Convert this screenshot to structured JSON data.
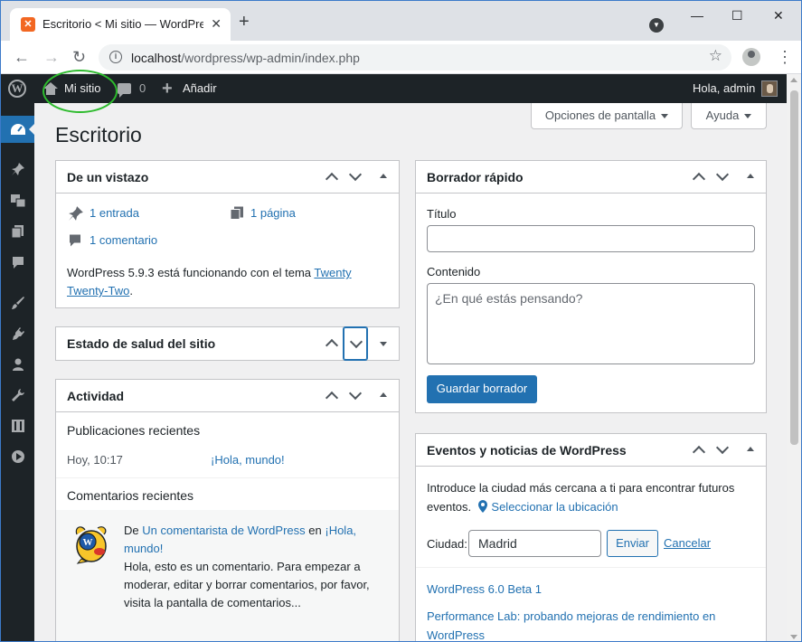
{
  "browser": {
    "tab_title": "Escritorio < Mi sitio — WordPress",
    "tab_close": "✕",
    "new_tab": "+",
    "url_host": "localhost",
    "url_path": "/wordpress/wp-admin/index.php",
    "window_minimize": "—",
    "window_maximize": "☐",
    "window_close": "✕"
  },
  "adminbar": {
    "site_name": "Mi sitio",
    "comments_count": "0",
    "add_new": "Añadir",
    "greeting": "Hola, admin"
  },
  "header": {
    "screen_options": "Opciones de pantalla",
    "help": "Ayuda",
    "title": "Escritorio"
  },
  "glance": {
    "title": "De un vistazo",
    "posts": "1 entrada",
    "pages": "1 página",
    "comments": "1 comentario",
    "running_text": "WordPress 5.9.3 está funcionando con el tema",
    "theme_link": "Twenty Twenty-Two",
    "period": "."
  },
  "health": {
    "title": "Estado de salud del sitio"
  },
  "activity": {
    "title": "Actividad",
    "recent_posts_heading": "Publicaciones recientes",
    "post_date": "Hoy, 10:17",
    "post_title": "¡Hola, mundo!",
    "recent_comments_heading": "Comentarios recientes",
    "comment_from": "De",
    "comment_author": "Un comentarista de WordPress",
    "comment_on": "en",
    "comment_post": "¡Hola, mundo!",
    "comment_excerpt": "Hola, esto es un comentario. Para empezar a moderar, editar y borrar comentarios, por favor, visita la pantalla de comentarios..."
  },
  "quick_draft": {
    "title": "Borrador rápido",
    "title_label": "Título",
    "title_value": "",
    "content_label": "Contenido",
    "content_placeholder": "¿En qué estás pensando?",
    "save_button": "Guardar borrador"
  },
  "events": {
    "title": "Eventos y noticias de WordPress",
    "intro": "Introduce la ciudad más cercana a ti para encontrar futuros eventos.",
    "select_location": "Seleccionar la ubicación",
    "city_label": "Ciudad:",
    "city_value": "Madrid",
    "submit_button": "Enviar",
    "cancel_link": "Cancelar",
    "news": [
      "WordPress 6.0 Beta 1",
      "Performance Lab: probando mejoras de rendimiento en WordPress"
    ]
  },
  "colors": {
    "admin_dark": "#1d2327",
    "accent": "#2271b1",
    "highlight_ring": "#2dbb2d"
  }
}
